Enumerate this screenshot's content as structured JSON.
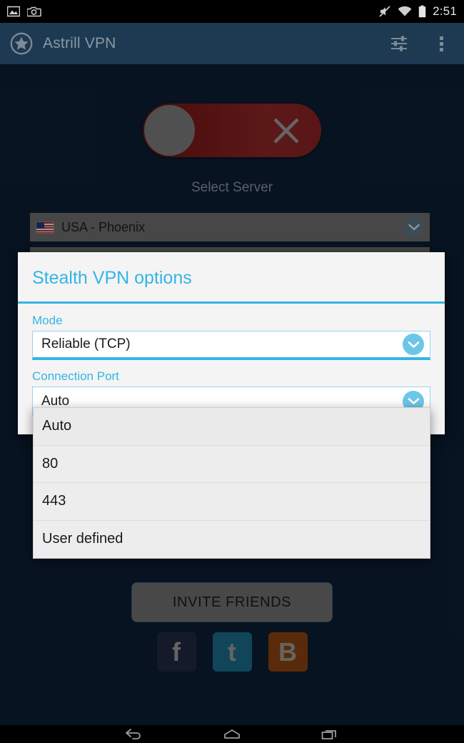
{
  "status_bar": {
    "time": "2:51",
    "icons_left": [
      "image-icon",
      "camera-icon"
    ],
    "icons_right": [
      "mute-icon",
      "wifi-icon",
      "battery-icon"
    ]
  },
  "app_bar": {
    "title": "Astrill VPN",
    "logo": "astrill-star-logo",
    "settings_icon": "sliders-icon",
    "overflow_icon": "overflow-menu-icon",
    "background": "#1d3a52"
  },
  "main": {
    "connection_toggle": {
      "state": "off",
      "icon": "close-x-icon",
      "track_color": "#8a2323",
      "knob_color": "#7b7b7b"
    },
    "select_server_label": "Select Server",
    "server": {
      "name": "USA - Phoenix",
      "flag": "usa-flag-icon",
      "chevron": "chevron-down-icon"
    },
    "invite_button_label": "INVITE FRIENDS",
    "social": [
      {
        "name": "facebook",
        "glyph": "f",
        "color": "#20293f"
      },
      {
        "name": "twitter",
        "glyph": "t",
        "color": "#1a6a8a"
      },
      {
        "name": "blogger",
        "glyph": "B",
        "color": "#8a4310"
      }
    ]
  },
  "dialog": {
    "title": "Stealth VPN options",
    "accent_color": "#33b5e5",
    "fields": [
      {
        "label": "Mode",
        "value": "Reliable (TCP)"
      },
      {
        "label": "Connection Port",
        "value": "Auto"
      }
    ]
  },
  "dropdown": {
    "open_for": "Connection Port",
    "selected": "Auto",
    "options": [
      "Auto",
      "80",
      "443",
      "User defined"
    ]
  },
  "nav_bar": {
    "back": "back-icon",
    "home": "home-icon",
    "recents": "recents-icon"
  }
}
